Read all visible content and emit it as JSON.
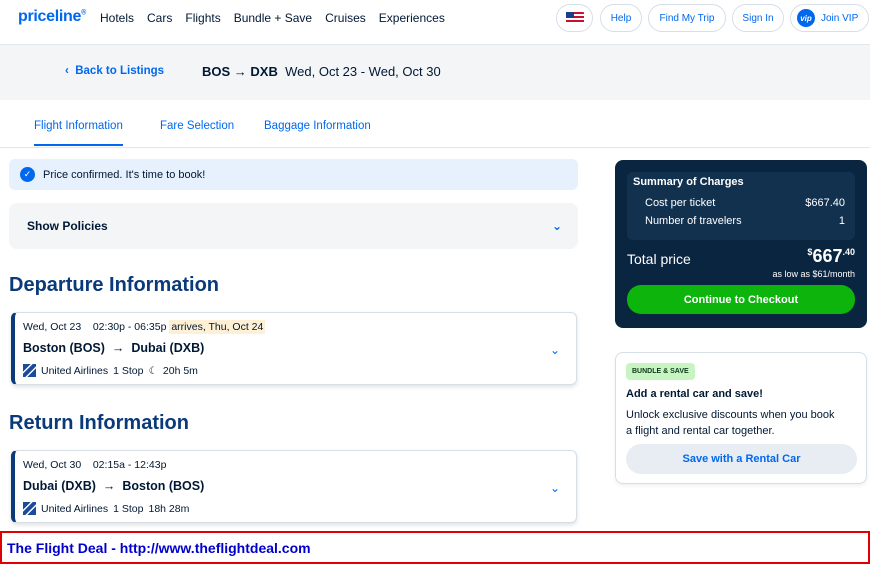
{
  "brand": {
    "logo": "priceline",
    "logo_mark": "®"
  },
  "nav": {
    "links": [
      "Hotels",
      "Cars",
      "Flights",
      "Bundle + Save",
      "Cruises",
      "Experiences"
    ],
    "help": "Help",
    "find_trip": "Find My Trip",
    "sign_in": "Sign In",
    "vip_badge": "vip",
    "join_vip": "Join VIP"
  },
  "subheader": {
    "back_label": "Back to Listings",
    "origin": "BOS",
    "arrow": "→",
    "destination": "DXB",
    "dates": "Wed, Oct 23 - Wed, Oct 30"
  },
  "tabs": [
    "Flight Information",
    "Fare Selection",
    "Baggage Information"
  ],
  "confirm_message": "Price confirmed. It's time to book!",
  "policies_label": "Show Policies",
  "departure": {
    "title": "Departure Information",
    "date": "Wed, Oct 23",
    "times": "02:30p - 06:35p",
    "arrives": "arrives, Thu, Oct 24",
    "from": "Boston (BOS)",
    "to": "Dubai (DXB)",
    "airline": "United Airlines",
    "stops": "1 Stop",
    "duration": "20h 5m"
  },
  "return": {
    "title": "Return Information",
    "date": "Wed, Oct 30",
    "times": "02:15a - 12:43p",
    "from": "Dubai (DXB)",
    "to": "Boston (BOS)",
    "airline": "United Airlines",
    "stops": "1 Stop",
    "duration": "18h 28m"
  },
  "summary": {
    "title": "Summary of Charges",
    "cost_label": "Cost per ticket",
    "cost_value": "$667.40",
    "travelers_label": "Number of travelers",
    "travelers_value": "1",
    "total_label": "Total price",
    "total_currency": "$",
    "total_whole": "667",
    "total_cents": ".40",
    "monthly": "as low as $61/month",
    "checkout_label": "Continue to Checkout"
  },
  "bundle": {
    "badge": "BUNDLE & SAVE",
    "title": "Add a rental car and save!",
    "description": "Unlock exclusive discounts when you book a flight and rental car together.",
    "button_label": "Save with a Rental Car"
  },
  "footer_text": "The Flight Deal - http://www.theflightdeal.com",
  "colors": {
    "accent": "#0068ef",
    "heading": "#0a3a7a",
    "summary_bg": "#0a2540",
    "checkout_green": "#0cb40c",
    "footer_border": "#e00000"
  }
}
